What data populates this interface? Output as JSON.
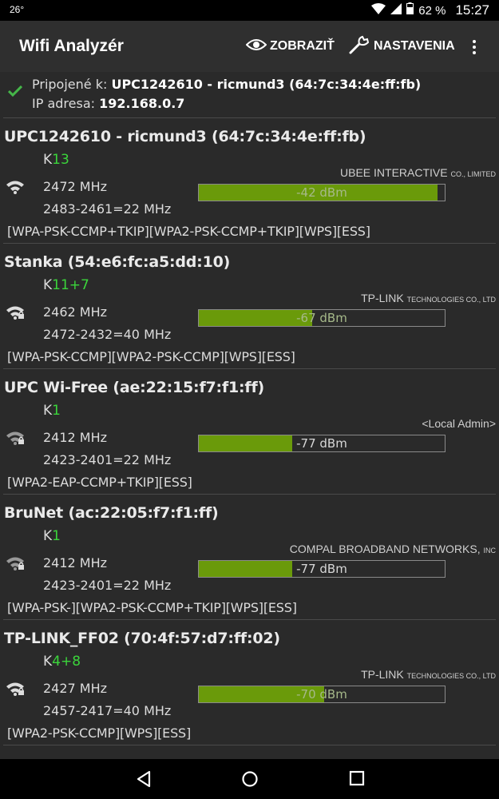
{
  "status_bar": {
    "temperature": "26°",
    "battery_percent": "62 %",
    "time": "15:27"
  },
  "toolbar": {
    "title": "Wifi Analyzér",
    "show_label": "ZOBRAZIŤ",
    "settings_label": "NASTAVENIA"
  },
  "connection": {
    "connected_prefix": "Pripojené k:",
    "connected_value": "UPC1242610 - ricmund3 (64:7c:34:4e:ff:fb)",
    "ip_prefix": "IP adresa:",
    "ip_value": "192.168.0.7"
  },
  "networks": [
    {
      "ssid": "UPC1242610 - ricmund3 (64:7c:34:4e:ff:fb)",
      "channel_prefix": "K",
      "channel": "13",
      "frequency": "2472 MHz",
      "range": "2483-2461=22 MHz",
      "security": "[WPA-PSK-CCMP+TKIP][WPA2-PSK-CCMP+TKIP][WPS][ESS]",
      "vendor": "UBEE INTERACTIVE",
      "vendor_suffix": "CO., LIMITED",
      "signal": "-42 dBm",
      "signal_fill": 0.97,
      "locked": false
    },
    {
      "ssid": "Stanka (54:e6:fc:a5:dd:10)",
      "channel_prefix": "K",
      "channel": "11+7",
      "frequency": "2462 MHz",
      "range": "2472-2432=40 MHz",
      "security": "[WPA-PSK-CCMP][WPA2-PSK-CCMP][WPS][ESS]",
      "vendor": "TP-LINK",
      "vendor_suffix": "TECHNOLOGIES CO., LTD",
      "signal": "-67 dBm",
      "signal_fill": 0.46,
      "locked": true
    },
    {
      "ssid": "UPC Wi-Free (ae:22:15:f7:f1:ff)",
      "channel_prefix": "K",
      "channel": "1",
      "frequency": "2412 MHz",
      "range": "2423-2401=22 MHz",
      "security": "[WPA2-EAP-CCMP+TKIP][ESS]",
      "vendor": "<Local Admin>",
      "vendor_suffix": "",
      "signal": "-77 dBm",
      "signal_fill": 0.38,
      "locked": true
    },
    {
      "ssid": "BruNet (ac:22:05:f7:f1:ff)",
      "channel_prefix": "K",
      "channel": "1",
      "frequency": "2412 MHz",
      "range": "2423-2401=22 MHz",
      "security": "[WPA-PSK-][WPA2-PSK-CCMP+TKIP][WPS][ESS]",
      "vendor": "COMPAL BROADBAND NETWORKS,",
      "vendor_suffix": "INC",
      "signal": "-77 dBm",
      "signal_fill": 0.38,
      "locked": true
    },
    {
      "ssid": "TP-LINK_FF02 (70:4f:57:d7:ff:02)",
      "channel_prefix": "K",
      "channel": "4+8",
      "frequency": "2427 MHz",
      "range": "2457-2417=40 MHz",
      "security": "[WPA2-PSK-CCMP][WPS][ESS]",
      "vendor": "TP-LINK",
      "vendor_suffix": "TECHNOLOGIES CO., LTD",
      "signal": "-70 dBm",
      "signal_fill": 0.51,
      "locked": true
    }
  ],
  "colors": {
    "accent_green": "#3bd53b",
    "signal_fill": "#6a9a0a",
    "check_green": "#45b649"
  }
}
